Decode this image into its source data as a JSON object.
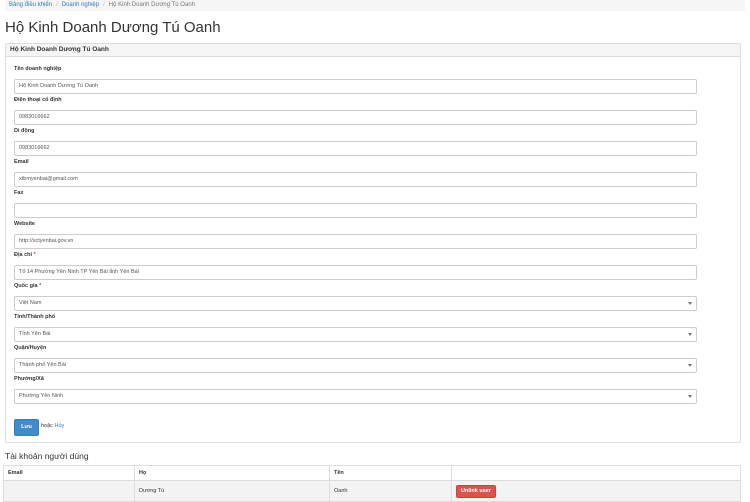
{
  "breadcrumb": {
    "items": [
      "Bảng điều khiển",
      "Doanh nghiệp"
    ],
    "current": "Hộ Kinh Doanh Dương Tú Oanh"
  },
  "page": {
    "title": "Hộ Kinh Doanh Dương Tú Oanh"
  },
  "panel": {
    "heading": "Hộ Kinh Doanh Dương Tú Oanh",
    "fields": [
      {
        "label": "Tên doanh nghiệp",
        "value": "Hộ Kinh Doanh Dương Tú Oanh"
      },
      {
        "label": "Điện thoại cố định",
        "value": "0983016662"
      },
      {
        "label": "Di động",
        "value": "0983016662"
      },
      {
        "label": "Email",
        "value": "xtbmyenbai@gmail.com"
      },
      {
        "label": "Fax",
        "value": ""
      },
      {
        "label": "Website",
        "value": "http://sctyenbai.gov.vn"
      },
      {
        "label": "Địa chỉ",
        "required": "*",
        "value": "Tổ 14 Phường Yên Ninh TP Yên Bái tỉnh Yên Bái"
      },
      {
        "label": "Quốc gia",
        "required": "*",
        "value": "Việt Nam"
      },
      {
        "label": "Tỉnh/Thành phố",
        "value": "Tỉnh Yên Bái"
      },
      {
        "label": "Quận/Huyện",
        "value": "Thành phố Yên Bái"
      },
      {
        "label": "Phường/Xã",
        "value": "Phường Yên Ninh"
      }
    ],
    "save_label": "Lưu",
    "or_label": "hoặc",
    "cancel_label": "Hủy"
  },
  "users": {
    "title": "Tài khoản người dùng",
    "columns": [
      "Email",
      "Họ",
      "Tên",
      ""
    ],
    "rows": [
      {
        "email": "",
        "ho": "Dương Tú",
        "ten": "Oanh",
        "action": "Unlink user"
      }
    ]
  },
  "colors": {
    "primary_button": "#428bca",
    "danger_button": "#d9534f",
    "link": "#337ab7"
  }
}
